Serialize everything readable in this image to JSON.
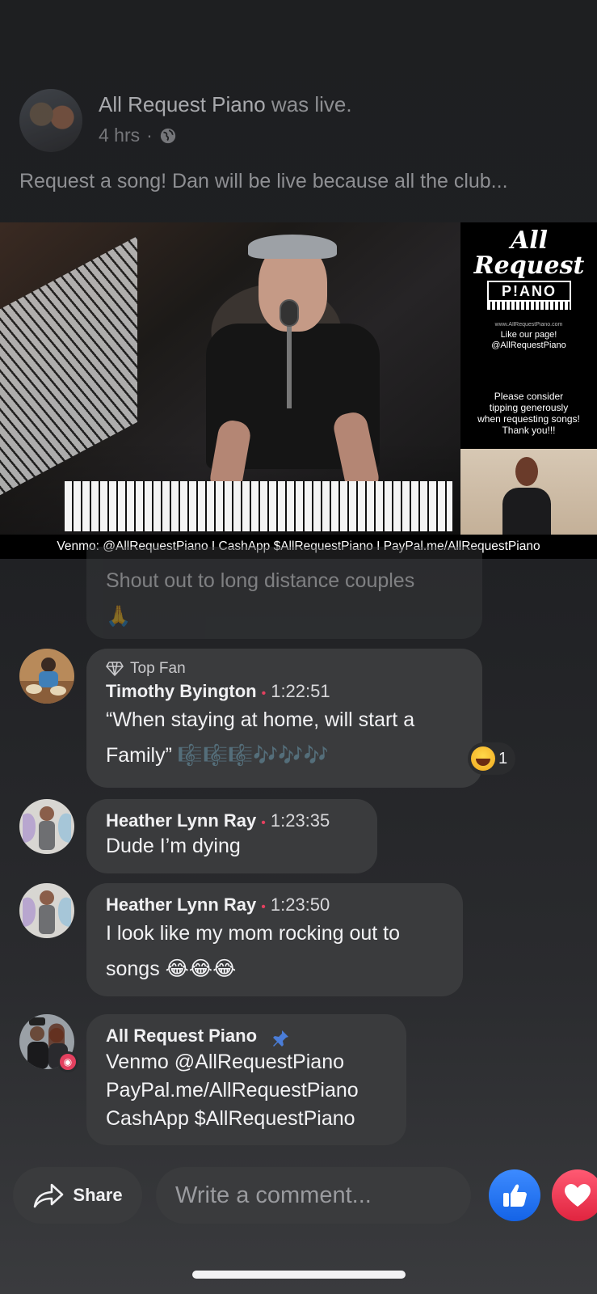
{
  "post": {
    "page_name": "All Request Piano",
    "status": " was live.",
    "time": "4 hrs",
    "separator": "·",
    "text": "Request a song! Dan will be live because all the club..."
  },
  "video": {
    "logo_all": "All",
    "logo_request": "Request",
    "logo_piano": "P!ANO",
    "logo_url": "www.AllRequestPiano.com",
    "like_page": "Like our page!",
    "handle": "@AllRequestPiano",
    "tip_line1": "Please consider",
    "tip_line2": "tipping generously",
    "tip_line3": "when requesting songs!",
    "tip_line4": "Thank you!!!",
    "banner": "Venmo: @AllRequestPiano  I  CashApp $AllRequestPiano  I  PayPal.me/AllRequestPiano"
  },
  "comments": {
    "partial": {
      "text": "Shout out to long distance couples",
      "emoji": "🙏"
    },
    "c1": {
      "badge": "Top Fan",
      "name": "Timothy Byington",
      "dot": "•",
      "time": "1:22:51",
      "line1": "“When staying at home, will start a",
      "line2": "Family” 🎼🎼🎼🎶🎶🎶",
      "reaction_count": "1"
    },
    "c2": {
      "name": "Heather Lynn Ray",
      "dot": "•",
      "time": "1:23:35",
      "text": "Dude I’m dying"
    },
    "c3": {
      "name": "Heather Lynn Ray",
      "dot": "•",
      "time": "1:23:50",
      "line1": "I look like my mom rocking out to",
      "line2": "songs 😂😂😂"
    },
    "c4": {
      "name": "All Request Piano",
      "line1": "Venmo @AllRequestPiano",
      "line2": "PayPal.me/AllRequestPiano",
      "line3": "CashApp $AllRequestPiano"
    }
  },
  "bottom_bar": {
    "share_label": "Share",
    "comment_placeholder": "Write a comment..."
  },
  "colors": {
    "accent_blue": "#1877f2",
    "live_red": "#e4405f",
    "love_red": "#f33e58"
  }
}
